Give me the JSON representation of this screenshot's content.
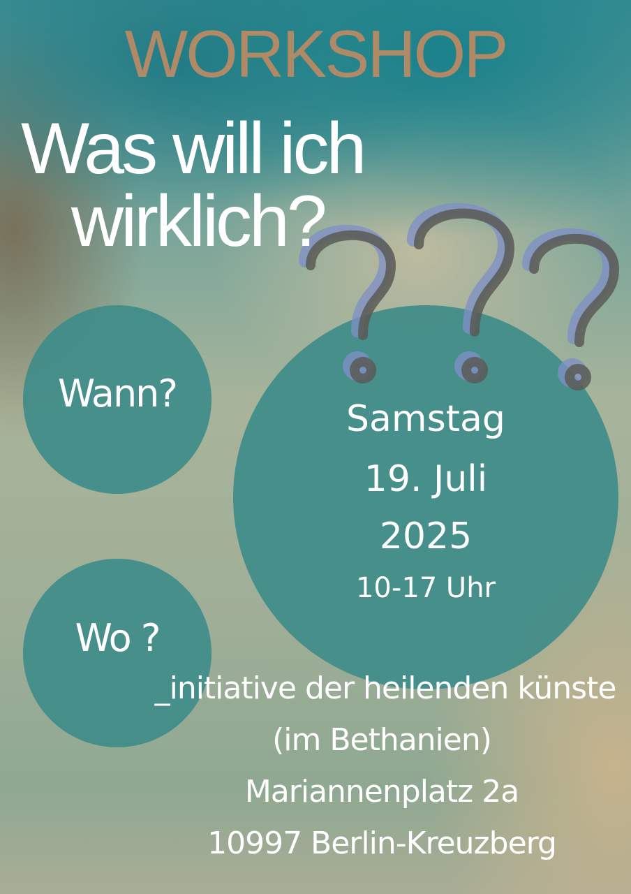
{
  "poster": {
    "kicker": "WORKSHOP",
    "title_line1": "Was will ich",
    "title_line2": "wirklich?",
    "when_label": "Wann?",
    "where_label": "Wo ?",
    "date": {
      "day": "Samstag",
      "date": "19. Juli",
      "year": "2025",
      "time": "10-17 Uhr"
    },
    "address": [
      "_initiative der heilenden künste",
      "(im Bethanien)",
      "Mariannenplatz 2a",
      "10997 Berlin-Kreuzberg"
    ]
  },
  "colors": {
    "kicker": "#b08a66",
    "circle": "#3f8c89",
    "text": "#ffffff",
    "question_marks": "#5a5a55",
    "question_marks_shadow": "#7f8fc8"
  },
  "icons": [
    "question-mark-icon",
    "question-mark-icon",
    "question-mark-icon"
  ]
}
